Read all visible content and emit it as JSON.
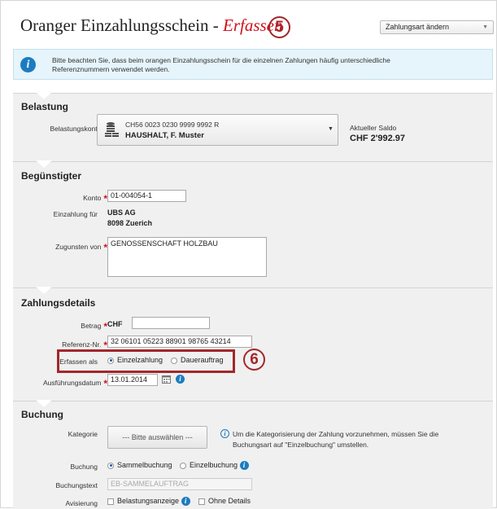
{
  "header": {
    "title": "Oranger Einzahlungsschein -",
    "status": "Erfassen",
    "marker_title": "5",
    "payment_type_button": "Zahlungsart ändern"
  },
  "info": {
    "text": "Bitte beachten Sie, dass beim orangen Einzahlungsschein für die einzelnen Zahlungen häufig unterschiedliche Referenznummern verwendet werden."
  },
  "belastung": {
    "title": "Belastung",
    "account_label": "Belastungskonto",
    "account_iban": "CH56 0023 0230 9999 9992 R",
    "account_name": "HAUSHALT, F. Muster",
    "balance_label": "Aktueller Saldo",
    "balance_value": "CHF 2'992.97"
  },
  "beguenstigter": {
    "title": "Begünstigter",
    "konto_label": "Konto",
    "konto_value": "01-004054-1",
    "einzahlung_label": "Einzahlung für",
    "einzahlung_name": "UBS AG",
    "einzahlung_city": "8098 Zuerich",
    "zugunsten_label": "Zugunsten von",
    "zugunsten_value": "GENOSSENSCHAFT HOLZBAU"
  },
  "zahlungsdetails": {
    "title": "Zahlungsdetails",
    "betrag_label": "Betrag",
    "currency": "CHF",
    "betrag_value": "",
    "referenz_label": "Referenz-Nr.",
    "referenz_value": "32 06101 05223 88901 98765 43214",
    "erfassen_label": "Erfassen als",
    "option_single": "Einzelzahlung",
    "option_standing": "Dauerauftrag",
    "marker_highlight": "6",
    "datum_label": "Ausführungsdatum",
    "datum_value": "13.01.2014"
  },
  "buchung": {
    "title": "Buchung",
    "kategorie_label": "Kategorie",
    "kategorie_button": "--- Bitte auswählen ---",
    "kategorie_hint": "Um die Kategorisierung der Zahlung vorzunehmen, müssen Sie die Buchungsart auf \"Einzelbuchung\" umstellen.",
    "buchung_label": "Buchung",
    "option_sammel": "Sammelbuchung",
    "option_einzel": "Einzelbuchung",
    "buchungstext_label": "Buchungstext",
    "buchungstext_value": "EB-SAMMELAUFTRAG",
    "avisierung_label": "Avisierung",
    "avis_option1": "Belastungsanzeige",
    "avis_option2": "Ohne Details"
  },
  "colors": {
    "accent_red": "#d0101b",
    "marker_red": "#a3262a",
    "info_blue": "#1c7cc0",
    "section_grey": "#f0f0f0",
    "info_bg": "#e6f4fb"
  },
  "icons": [
    "info-icon",
    "coin-stack-icon",
    "dropdown-arrow-icon",
    "calendar-icon",
    "help-icon"
  ]
}
